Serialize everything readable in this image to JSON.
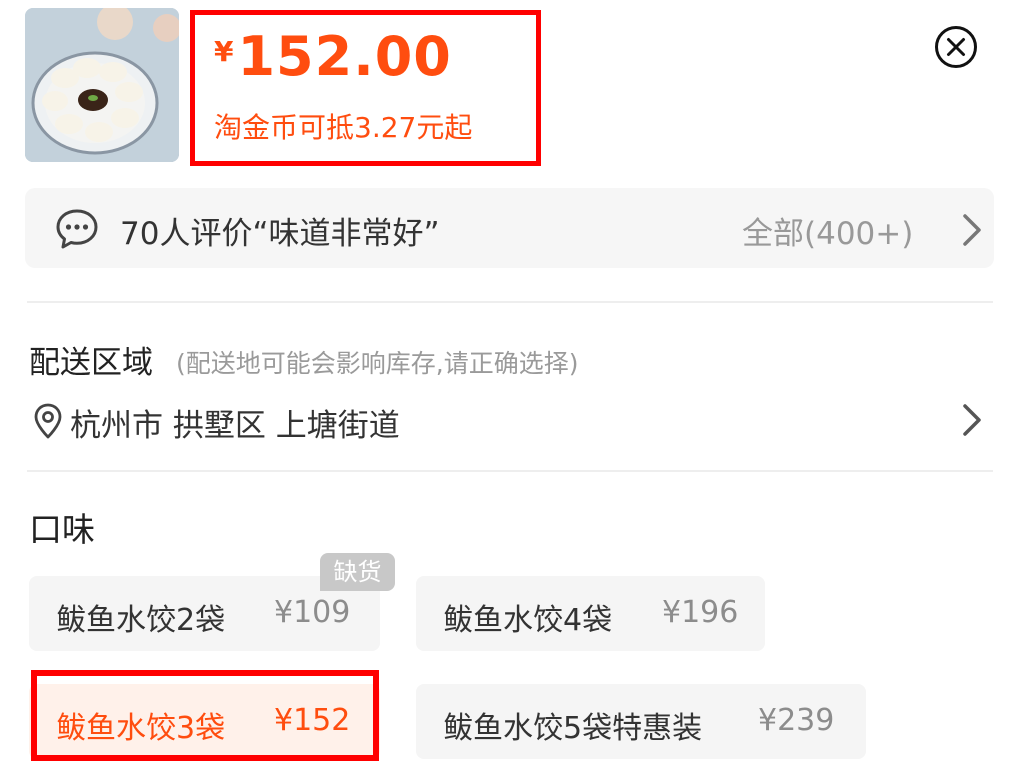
{
  "product": {
    "thumbnail_icon": "dumplings-photo",
    "currency_symbol": "¥",
    "price": "152.00",
    "coin_discount": "淘金币可抵3.27元起"
  },
  "header": {
    "close_icon": "close-circle-icon"
  },
  "reviews": {
    "summary": "70人评价“味道非常好”",
    "all_label": "全部(400+)"
  },
  "delivery": {
    "title": "配送区域",
    "hint": "(配送地可能会影响库存,请正确选择)",
    "location": "杭州市 拱墅区 上塘街道"
  },
  "flavor": {
    "title": "口味",
    "options": [
      {
        "name": "鲅鱼水饺2袋",
        "price": "¥109",
        "tag": "缺货"
      },
      {
        "name": "鲅鱼水饺4袋",
        "price": "¥196"
      },
      {
        "name": "鲅鱼水饺3袋",
        "price": "¥152",
        "selected": true
      },
      {
        "name": "鲅鱼水饺5袋特惠装",
        "price": "¥239"
      }
    ]
  },
  "colors": {
    "accent": "#ff4d0f",
    "highlight_box": "#ff0000",
    "muted_text": "#999999",
    "option_bg": "#f5f5f5"
  }
}
